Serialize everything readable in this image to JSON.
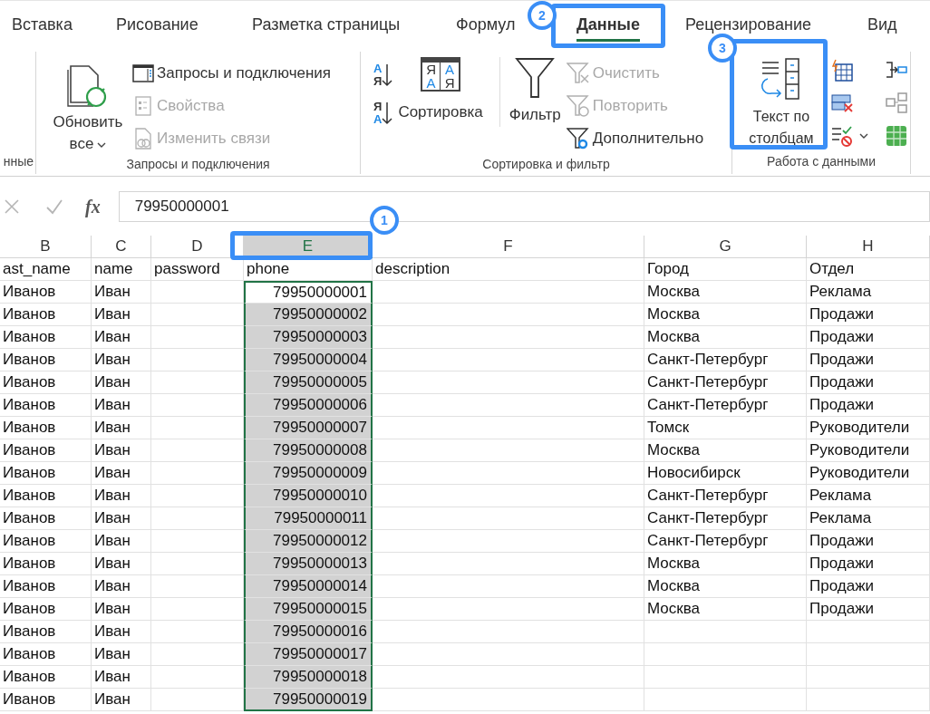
{
  "tabs": [
    {
      "label": "Вставка",
      "selected": false
    },
    {
      "label": "Рисование",
      "selected": false
    },
    {
      "label": "Разметка страницы",
      "selected": false
    },
    {
      "label": "Формул",
      "selected": false
    },
    {
      "label": "Данные",
      "selected": true
    },
    {
      "label": "Рецензирование",
      "selected": false
    },
    {
      "label": "Вид",
      "selected": false
    }
  ],
  "ribbon": {
    "groups": [
      {
        "label": "нные"
      },
      {
        "label": "Запросы и подключения",
        "large_button": {
          "label": "Обновить все"
        },
        "buttons": [
          {
            "label": "Запросы и подключения",
            "disabled": false
          },
          {
            "label": "Свойства",
            "disabled": true
          },
          {
            "label": "Изменить связи",
            "disabled": true
          }
        ]
      },
      {
        "label": "Сортировка и фильтр",
        "sort_buttons": [
          {
            "top": "А",
            "bottom": "Я"
          },
          {
            "top": "Я",
            "bottom": "А"
          }
        ],
        "sort_icon_letters": [
          "Я",
          "А",
          "А",
          "Я"
        ],
        "sort_label": "Сортировка",
        "filter_label": "Фильтр",
        "buttons": [
          {
            "label": "Очистить",
            "disabled": true
          },
          {
            "label": "Повторить",
            "disabled": true
          },
          {
            "label": "Дополнительно",
            "disabled": false
          }
        ]
      },
      {
        "label": "Работа с данными",
        "large_button": {
          "label": "Текст по столбцам"
        }
      }
    ]
  },
  "formula_bar": {
    "fx": "fx",
    "value": "79950000001"
  },
  "table": {
    "columns": [
      {
        "letter": "B",
        "selected": false
      },
      {
        "letter": "C",
        "selected": false
      },
      {
        "letter": "D",
        "selected": false
      },
      {
        "letter": "E",
        "selected": true
      },
      {
        "letter": "F",
        "selected": false
      },
      {
        "letter": "G",
        "selected": false
      },
      {
        "letter": "H",
        "selected": false
      }
    ],
    "rows": [
      {
        "selected": false,
        "cells": [
          "ast_name",
          "name",
          "password",
          "phone",
          "description",
          "Город",
          "Отдел"
        ]
      },
      {
        "selected": true,
        "cells": [
          "Иванов",
          "Иван",
          "",
          "79950000001",
          "",
          "Москва",
          "Реклама"
        ]
      },
      {
        "selected": true,
        "cells": [
          "Иванов",
          "Иван",
          "",
          "79950000002",
          "",
          "Москва",
          "Продажи"
        ]
      },
      {
        "selected": true,
        "cells": [
          "Иванов",
          "Иван",
          "",
          "79950000003",
          "",
          "Москва",
          "Продажи"
        ]
      },
      {
        "selected": true,
        "cells": [
          "Иванов",
          "Иван",
          "",
          "79950000004",
          "",
          "Санкт-Петербург",
          "Продажи"
        ]
      },
      {
        "selected": true,
        "cells": [
          "Иванов",
          "Иван",
          "",
          "79950000005",
          "",
          "Санкт-Петербург",
          "Продажи"
        ]
      },
      {
        "selected": true,
        "cells": [
          "Иванов",
          "Иван",
          "",
          "79950000006",
          "",
          "Санкт-Петербург",
          "Продажи"
        ]
      },
      {
        "selected": true,
        "cells": [
          "Иванов",
          "Иван",
          "",
          "79950000007",
          "",
          "Томск",
          "Руководители"
        ]
      },
      {
        "selected": true,
        "cells": [
          "Иванов",
          "Иван",
          "",
          "79950000008",
          "",
          "Москва",
          "Руководители"
        ]
      },
      {
        "selected": true,
        "cells": [
          "Иванов",
          "Иван",
          "",
          "79950000009",
          "",
          "Новосибирск",
          "Руководители"
        ]
      },
      {
        "selected": true,
        "cells": [
          "Иванов",
          "Иван",
          "",
          "79950000010",
          "",
          "Санкт-Петербург",
          "Реклама"
        ]
      },
      {
        "selected": true,
        "cells": [
          "Иванов",
          "Иван",
          "",
          "79950000011",
          "",
          "Санкт-Петербург",
          "Реклама"
        ]
      },
      {
        "selected": true,
        "cells": [
          "Иванов",
          "Иван",
          "",
          "79950000012",
          "",
          "Санкт-Петербург",
          "Продажи"
        ]
      },
      {
        "selected": true,
        "cells": [
          "Иванов",
          "Иван",
          "",
          "79950000013",
          "",
          "Москва",
          "Продажи"
        ]
      },
      {
        "selected": true,
        "cells": [
          "Иванов",
          "Иван",
          "",
          "79950000014",
          "",
          "Москва",
          "Продажи"
        ]
      },
      {
        "selected": true,
        "cells": [
          "Иванов",
          "Иван",
          "",
          "79950000015",
          "",
          "Москва",
          "Продажи"
        ]
      },
      {
        "selected": true,
        "cells": [
          "Иванов",
          "Иван",
          "",
          "79950000016",
          "",
          "",
          ""
        ]
      },
      {
        "selected": true,
        "cells": [
          "Иванов",
          "Иван",
          "",
          "79950000017",
          "",
          "",
          ""
        ]
      },
      {
        "selected": true,
        "cells": [
          "Иванов",
          "Иван",
          "",
          "79950000018",
          "",
          "",
          ""
        ]
      },
      {
        "selected": true,
        "cells": [
          "Иванов",
          "Иван",
          "",
          "79950000019",
          "",
          "",
          ""
        ]
      }
    ]
  },
  "callouts": [
    {
      "number": "1"
    },
    {
      "number": "2"
    },
    {
      "number": "3"
    }
  ]
}
